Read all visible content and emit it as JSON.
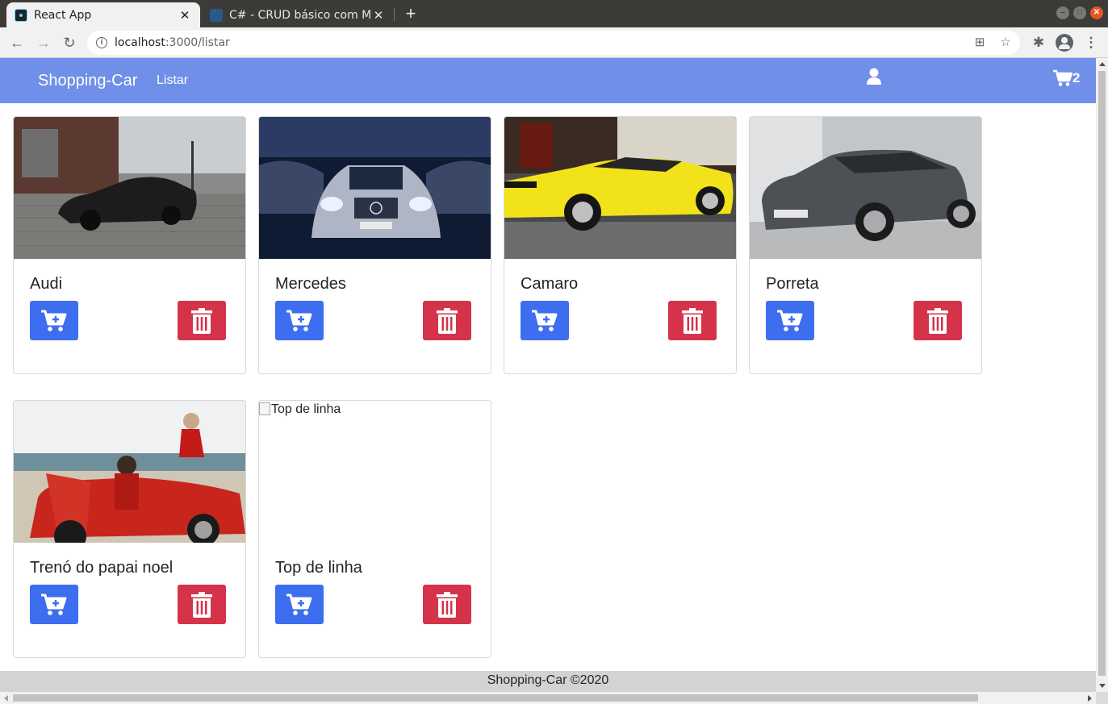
{
  "browser": {
    "tabs": [
      {
        "title": "React App",
        "active": true,
        "favicon": "react-icon"
      },
      {
        "title": "C# - CRUD básico com Mo",
        "active": false,
        "favicon": "document-icon"
      }
    ],
    "url_host": "localhost",
    "url_path": ":3000/listar",
    "colors": {
      "tabbar": "#3c3b37",
      "toolbar": "#f1f1f1"
    }
  },
  "navbar": {
    "brand": "Shopping-Car",
    "links": [
      "Listar"
    ],
    "cart_count": "2",
    "color": "#6f8fe8"
  },
  "products": [
    {
      "name": "Audi",
      "image": "audi-car-photo"
    },
    {
      "name": "Mercedes",
      "image": "mercedes-car-photo"
    },
    {
      "name": "Camaro",
      "image": "camaro-car-photo"
    },
    {
      "name": "Porreta",
      "image": "ford-car-photo"
    },
    {
      "name": "Trenó do papai noel",
      "image": "santa-car-photo"
    },
    {
      "name": "Top de linha",
      "image": "broken-image",
      "alt": "Top de linha"
    }
  ],
  "buttons": {
    "add_color": "#3d6ef0",
    "delete_color": "#d5334a"
  },
  "footer": {
    "text": "Shopping-Car ©2020"
  }
}
